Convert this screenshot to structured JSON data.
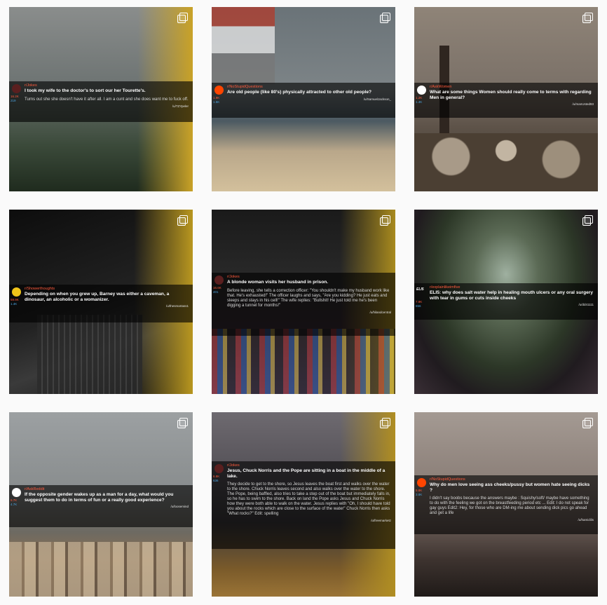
{
  "tiles": [
    {
      "subreddit": "r/Jokes",
      "title": "I took my wife to the doctor's to sort our her Tourette's.",
      "body": "Turns out she she doesn't have it after all. I am a cunt and she does want me to fuck off.",
      "upvotes": "16.2K",
      "comments": "219",
      "author": "/u/TZYpeler",
      "multi_icon": "carousel-icon"
    },
    {
      "subreddit": "r/NoStupidQuestions",
      "title": "Are old people (like 80's) physically attracted to other old people?",
      "body": "",
      "upvotes": "1.9K",
      "comments": "1.5K",
      "author": "/u/SamuelJackson_",
      "multi_icon": "carousel-icon"
    },
    {
      "subreddit": "r/AskWomen",
      "title": "What are some things Women should really come to terms with regarding Men in general?",
      "body": "",
      "upvotes": "1.2K",
      "comments": "1.4K",
      "author": "/u/manUsted93",
      "multi_icon": "carousel-icon"
    },
    {
      "subreddit": "r/Showerthoughts",
      "title": "Depending on when you grew up, Barney was either a caveman, a dinosaur, an alcoholic or a womanizer.",
      "body": "",
      "upvotes": "59.9K",
      "comments": "1.4K",
      "author": "/u/thesmartass1",
      "multi_icon": "carousel-icon"
    },
    {
      "subreddit": "r/Jokes",
      "title": "A blonde woman visits her husband in prison.",
      "body": "Before leaving, she tells a correction officer: \"You shouldn't make my husband work like that. He's exhausted!\" The officer laughs and says, \"Are you kidding? He just eats and sleeps and stays in his cell!\"  The wife replies: \"Bullshit! He just told me he's been digging a tunnel for months!\"",
      "upvotes": "16.6K",
      "comments": "401",
      "author": "/u/hilandcentral",
      "multi_icon": "carousel-icon"
    },
    {
      "subreddit": "r/explainlikeimfive",
      "title": "ELI5: why does salt water help in healing mouth ulcers or any oral surgery with tear in gums or cuts inside cheeks",
      "body": "",
      "upvotes": "7.9K",
      "comments": "656",
      "author": "/u/dd41111",
      "badge": "ELI5",
      "multi_icon": "carousel-icon"
    },
    {
      "subreddit": "r/AskReddit",
      "title": "If the opposite gender wakes up as a man for a day, what would you suggest them to do in terms of fun or a really good experience?",
      "body": "",
      "upvotes": "6.7K",
      "comments": "4.7K",
      "author": "/u/loosemind",
      "multi_icon": "carousel-icon"
    },
    {
      "subreddit": "r/Jokes",
      "title": "Jesus, Chuck Norris and the Pope are sitting in a boat in the middle of a lake.",
      "body": "They decide to get to the shore, so Jesus leaves the boat first and walks over the water to the shore.  Chuck Norris leaves second and also walks over the water to the shore. The Pope, being baffled, also tries to take a step out of the boat but immediately falls in, so he has to swim to the shore.  Back on land the Pope asks Jesus and Chuck Norris how they were both able to walk on the water. Jesus replies with \"Oh, I should have told you about the rocks which are close to the surface of the water\"  Chuck Norris then asks \"What rocks?\"  Edit: spelling",
      "upvotes": "6.8K",
      "comments": "636",
      "author": "/u/freemarketz",
      "multi_icon": "carousel-icon"
    },
    {
      "subreddit": "r/NoStupidQuestions",
      "title": "Why do men love seeing ass cheeks/pussy but women hate seeing dicks ?",
      "body": "I didn't say boobs because the answers maybe : Squishy/soft/ maybe have something to do with the feeling we got on the breastfeeding period etc ...  Edit: I do not speak for gay guys  Edit2: Hey, for those who are DM-ing me about sending dick pics go ahead and get a life",
      "upvotes": "5.8K",
      "comments": "3.8K",
      "author": "/u/hamidilis",
      "multi_icon": "carousel-icon"
    }
  ]
}
